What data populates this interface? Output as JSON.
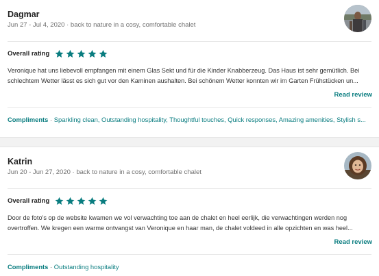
{
  "reviews": [
    {
      "name": "Dagmar",
      "dates": "Jun 27 - Jul 4, 2020",
      "property": "back to nature in a cosy, comfortable chalet",
      "rating_label": "Overall rating",
      "stars": 5,
      "text_lines": [
        "Veronique hat uns liebevoll empfangen mit einem Glas Sekt und für die Kinder Knabberzeug. Das Haus ist sehr gemütlich. Bei",
        "schlechtem Wetter lässt es sich gut vor den Kaminen aushalten. Bei schönem Wetter konnten wir im Garten Frühstücken un..."
      ],
      "read_review": "Read review",
      "compliments_label": "Compliments",
      "compliments": "Sparkling clean, Outstanding hospitality, Thoughtful touches, Quick responses, Amazing amenities, Stylish s..."
    },
    {
      "name": "Katrin",
      "dates": "Jun 20 - Jun 27, 2020",
      "property": "back to nature in a cosy, comfortable chalet",
      "rating_label": "Overall rating",
      "stars": 5,
      "text_lines": [
        "Door de foto's op de website kwamen we vol verwachting toe aan de chalet en heel eerlijk, die verwachtingen werden nog",
        "overtroffen. We kregen een warme ontvangst van Veronique en haar man, de chalet voldeed in alle opzichten en was heel..."
      ],
      "read_review": "Read review",
      "compliments_label": "Compliments",
      "compliments": "Outstanding hospitality"
    }
  ],
  "separator": "·",
  "colors": {
    "accent": "#0a7d80",
    "star": "#0a7d80",
    "muted": "#707070"
  },
  "icons": {
    "star": "star-icon",
    "avatar": "avatar"
  }
}
